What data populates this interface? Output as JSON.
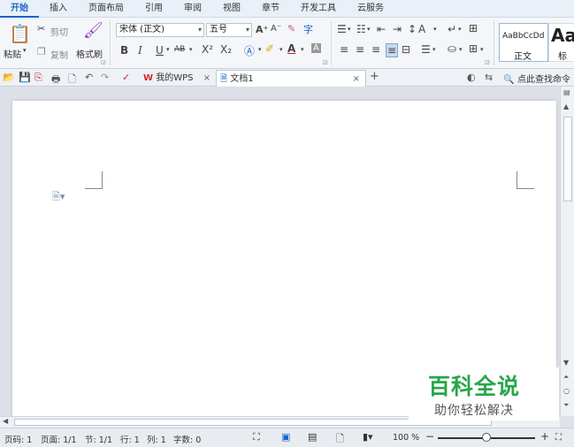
{
  "menu": {
    "tabs": [
      "开始",
      "插入",
      "页面布局",
      "引用",
      "审阅",
      "视图",
      "章节",
      "开发工具",
      "云服务"
    ],
    "active": "开始"
  },
  "ribbon": {
    "paste": "粘贴",
    "cut": "剪切",
    "copy": "复制",
    "format_painter": "格式刷",
    "font_name": "宋体 (正文)",
    "font_size": "五号",
    "style_normal_preview": "AaBbCcDd",
    "style_normal_label": "正文",
    "style_heading_preview": "Aa",
    "style_heading_label": "标"
  },
  "tabs": {
    "home": "我的WPS",
    "document": "文档1",
    "search": "点此查找命令"
  },
  "status": {
    "page_code": "页码: 1",
    "pages": "页面: 1/1",
    "section": "节: 1/1",
    "row": "行: 1",
    "col": "列: 1",
    "words": "字数: 0",
    "zoom": "100 %"
  },
  "watermark": {
    "title": "百科全说",
    "subtitle": "助你轻松解决"
  },
  "colors": {
    "accent": "#1a62c9",
    "wps_red": "#d5282c",
    "watermark_green": "#27a64a"
  }
}
